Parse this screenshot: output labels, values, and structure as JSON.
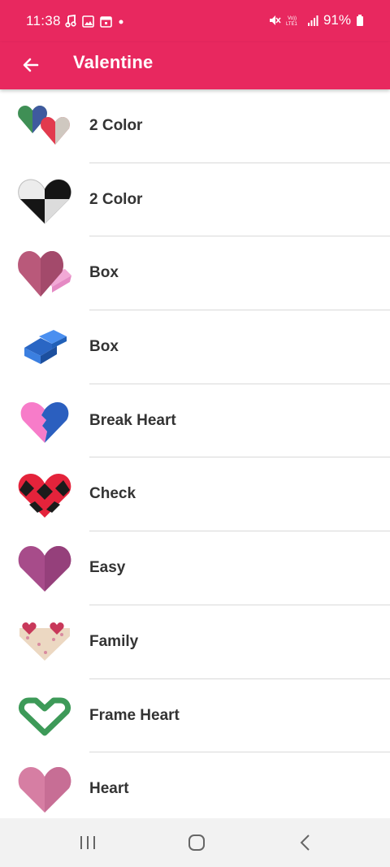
{
  "theme": {
    "accent": "#e8285f"
  },
  "status_bar": {
    "time": "11:38",
    "left_icons": [
      "music-note-icon",
      "image-icon",
      "calendar-icon",
      "dot-icon"
    ],
    "battery_text": "91%",
    "right_icons": [
      "mute-icon",
      "volte-icon",
      "signal-icon",
      "battery-icon"
    ]
  },
  "app_bar": {
    "title": "Valentine",
    "back_icon": "arrow-left-icon"
  },
  "items": [
    {
      "label": "2 Color",
      "thumb": "two-color-hearts-icon"
    },
    {
      "label": "2 Color",
      "thumb": "black-white-heart-icon"
    },
    {
      "label": "Box",
      "thumb": "heart-box-icon"
    },
    {
      "label": "Box",
      "thumb": "blue-box-icon"
    },
    {
      "label": "Break Heart",
      "thumb": "break-heart-icon"
    },
    {
      "label": "Check",
      "thumb": "check-heart-icon"
    },
    {
      "label": "Easy",
      "thumb": "easy-heart-icon"
    },
    {
      "label": "Family",
      "thumb": "family-heart-icon"
    },
    {
      "label": "Frame Heart",
      "thumb": "frame-heart-icon"
    },
    {
      "label": "Heart",
      "thumb": "pink-heart-icon"
    }
  ],
  "nav_bar": {
    "buttons": [
      "recents-icon",
      "home-icon",
      "back-icon"
    ]
  }
}
